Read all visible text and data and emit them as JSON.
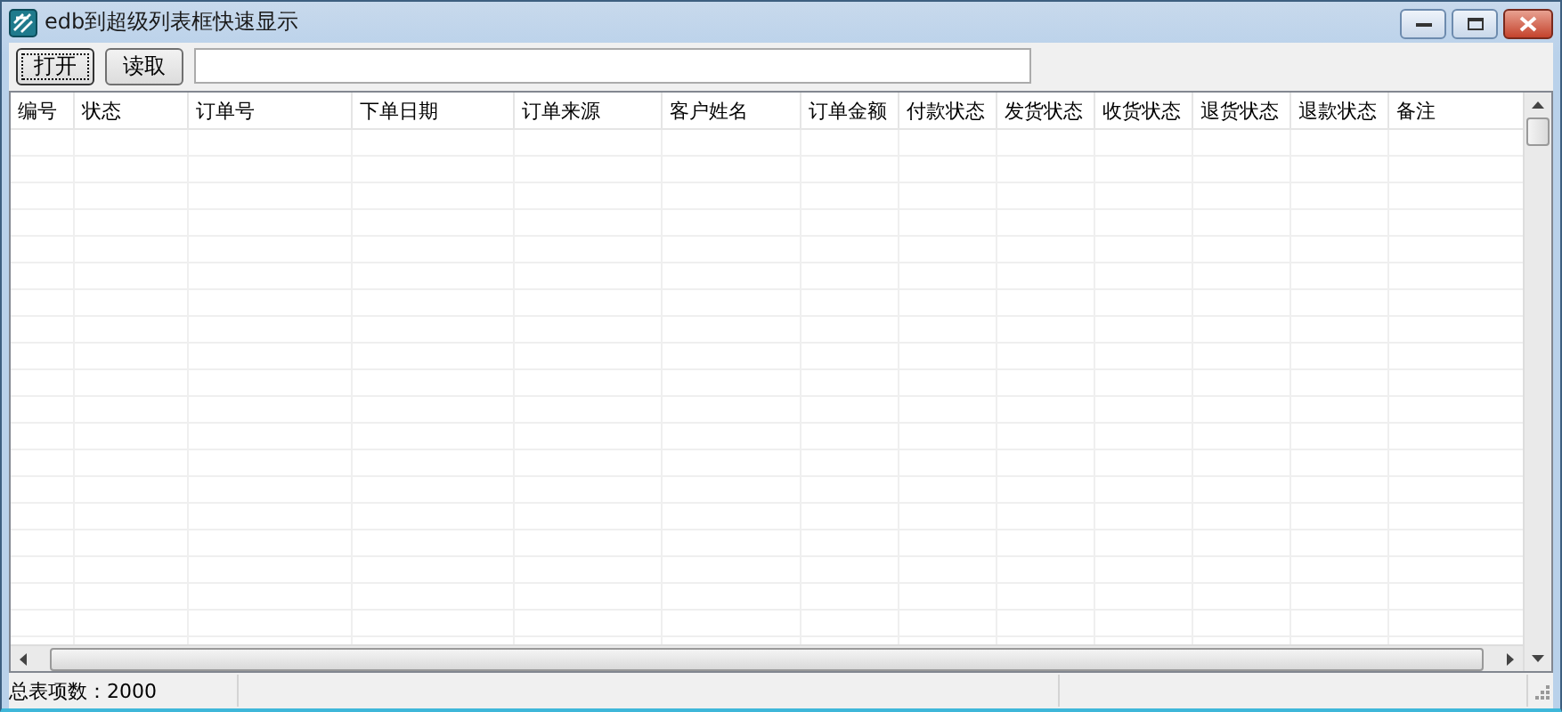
{
  "window": {
    "title": "edb到超级列表框快速显示"
  },
  "toolbar": {
    "buttons": [
      {
        "label": "打开",
        "focused": true
      },
      {
        "label": "读取",
        "focused": false
      }
    ]
  },
  "table": {
    "columns": [
      "编号",
      "状态",
      "订单号",
      "下单日期",
      "订单来源",
      "客户姓名",
      "订单金额",
      "付款状态",
      "发货状态",
      "收货状态",
      "退货状态",
      "退款状态",
      "备注"
    ]
  },
  "status_bar": {
    "text": "总表项数：2000"
  }
}
